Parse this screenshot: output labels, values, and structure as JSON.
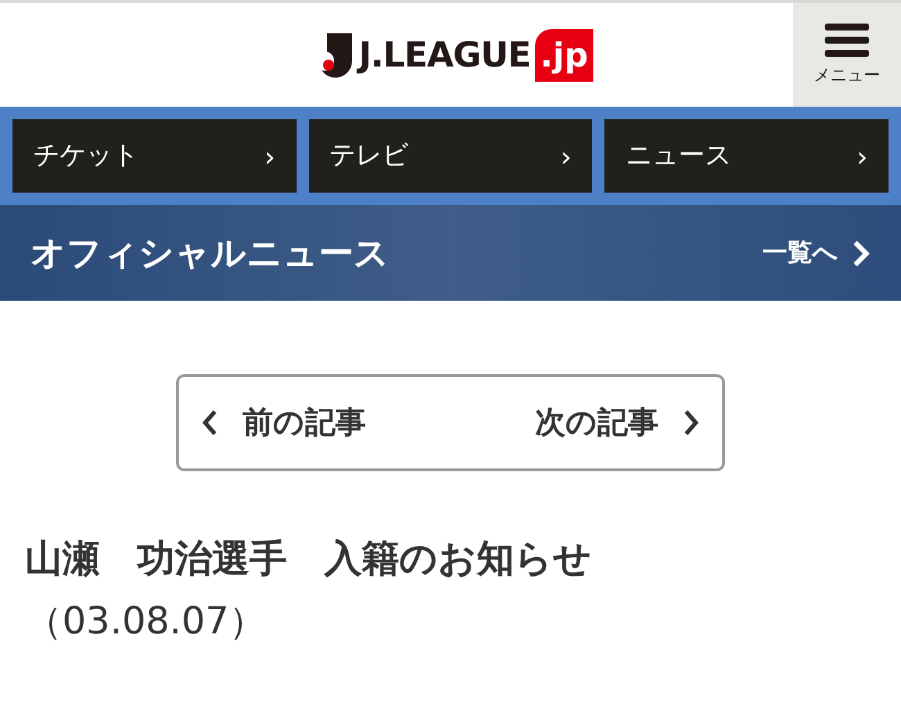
{
  "header": {
    "logo": {
      "wordmark": "J.LEAGUE",
      "suffix": ".jp"
    },
    "menu_button": {
      "label": "メニュー"
    }
  },
  "nav": [
    {
      "label": "チケット",
      "arrow": "›"
    },
    {
      "label": "テレビ",
      "arrow": "›"
    },
    {
      "label": "ニュース",
      "arrow": "›"
    }
  ],
  "section": {
    "title": "オフィシャルニュース",
    "link": "一覧へ"
  },
  "pager": {
    "prev": "前の記事",
    "next": "次の記事"
  },
  "article": {
    "title": "山瀬　功治選手　入籍のお知らせ",
    "date": "（03.08.07）"
  }
}
